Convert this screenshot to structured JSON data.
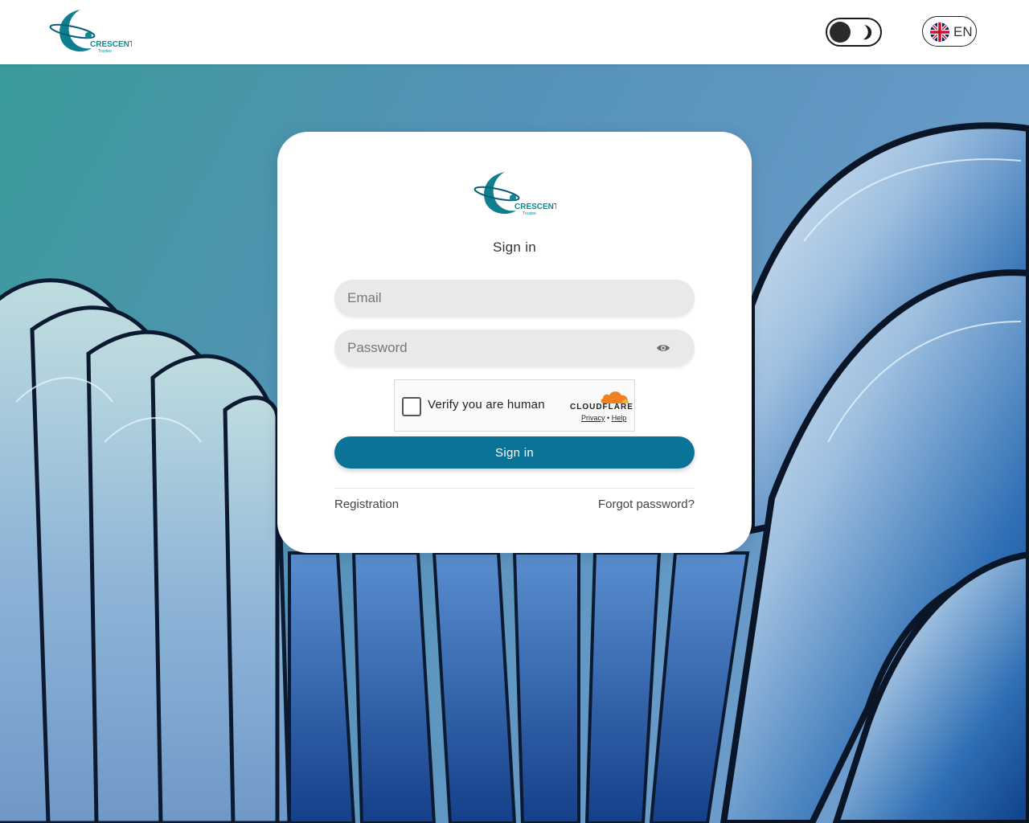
{
  "header": {
    "logo_word": "CRESCENT",
    "logo_sub": "Trustee",
    "language": "EN"
  },
  "card": {
    "logo_word": "CRESCENT",
    "logo_sub": "Trustee",
    "title": "Sign in",
    "email_placeholder": "Email",
    "password_placeholder": "Password",
    "captcha": {
      "label": "Verify you are human",
      "brand": "CLOUDFLARE",
      "privacy": "Privacy",
      "separator": "•",
      "help": "Help"
    },
    "signin_label": "Sign in",
    "registration_label": "Registration",
    "forgot_label": "Forgot password?"
  },
  "colors": {
    "brand_teal": "#0b7397",
    "logo_teal": "#0e8a8f",
    "cloudflare_orange": "#f38020"
  }
}
